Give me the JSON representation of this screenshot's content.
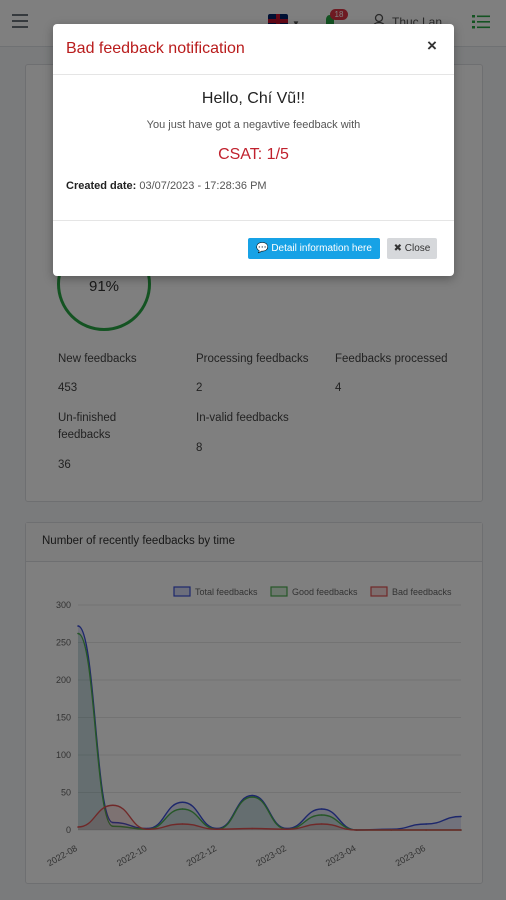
{
  "topbar": {
    "user_name": "Thuc Lan",
    "notification_count": "18"
  },
  "stats": {
    "gauge_value": "91%",
    "new_label": "New feedbacks",
    "new_value": "453",
    "processing_label": "Processing feedbacks",
    "processing_value": "2",
    "processed_label": "Feedbacks processed",
    "processed_value": "4",
    "unfinished_label": "Un-finished feedbacks",
    "unfinished_value": "36",
    "invalid_label": "In-valid feedbacks",
    "invalid_value": "8"
  },
  "chart_card": {
    "title": "Number of recently feedbacks by time"
  },
  "chart_data": {
    "type": "line",
    "x": [
      "2022-08",
      "2022-09",
      "2022-10",
      "2022-11",
      "2022-12",
      "2023-01",
      "2023-02",
      "2023-03",
      "2023-04",
      "2023-05",
      "2023-06",
      "2023-07"
    ],
    "tick_labels": [
      "2022-08",
      "2022-10",
      "2022-12",
      "2023-02",
      "2023-04",
      "2023-06"
    ],
    "series": [
      {
        "name": "Total feedbacks",
        "color": "#3b4fd8",
        "values": [
          272,
          10,
          2,
          37,
          2,
          46,
          2,
          28,
          0,
          1,
          8,
          18
        ]
      },
      {
        "name": "Good feedbacks",
        "color": "#4caf50",
        "values": [
          262,
          5,
          1,
          28,
          1,
          44,
          1,
          20,
          0,
          0,
          0,
          0
        ]
      },
      {
        "name": "Bad feedbacks",
        "color": "#e05252",
        "values": [
          4,
          33,
          1,
          8,
          1,
          2,
          1,
          8,
          0,
          0,
          0,
          0
        ]
      }
    ],
    "ylim": [
      0,
      300
    ],
    "yticks": [
      0,
      50,
      100,
      150,
      200,
      250,
      300
    ],
    "legend": "top",
    "grid": true
  },
  "modal": {
    "title": "Bad feedback notification",
    "close_symbol": "×",
    "greeting": "Hello, Chí Vũ!!",
    "message": "You just have got a negavtive feedback with",
    "csat": "CSAT: 1/5",
    "created_label": "Created date:",
    "created_value": "03/07/2023 - 17:28:36 PM",
    "detail_button": "Detail information here",
    "close_button": "Close"
  }
}
